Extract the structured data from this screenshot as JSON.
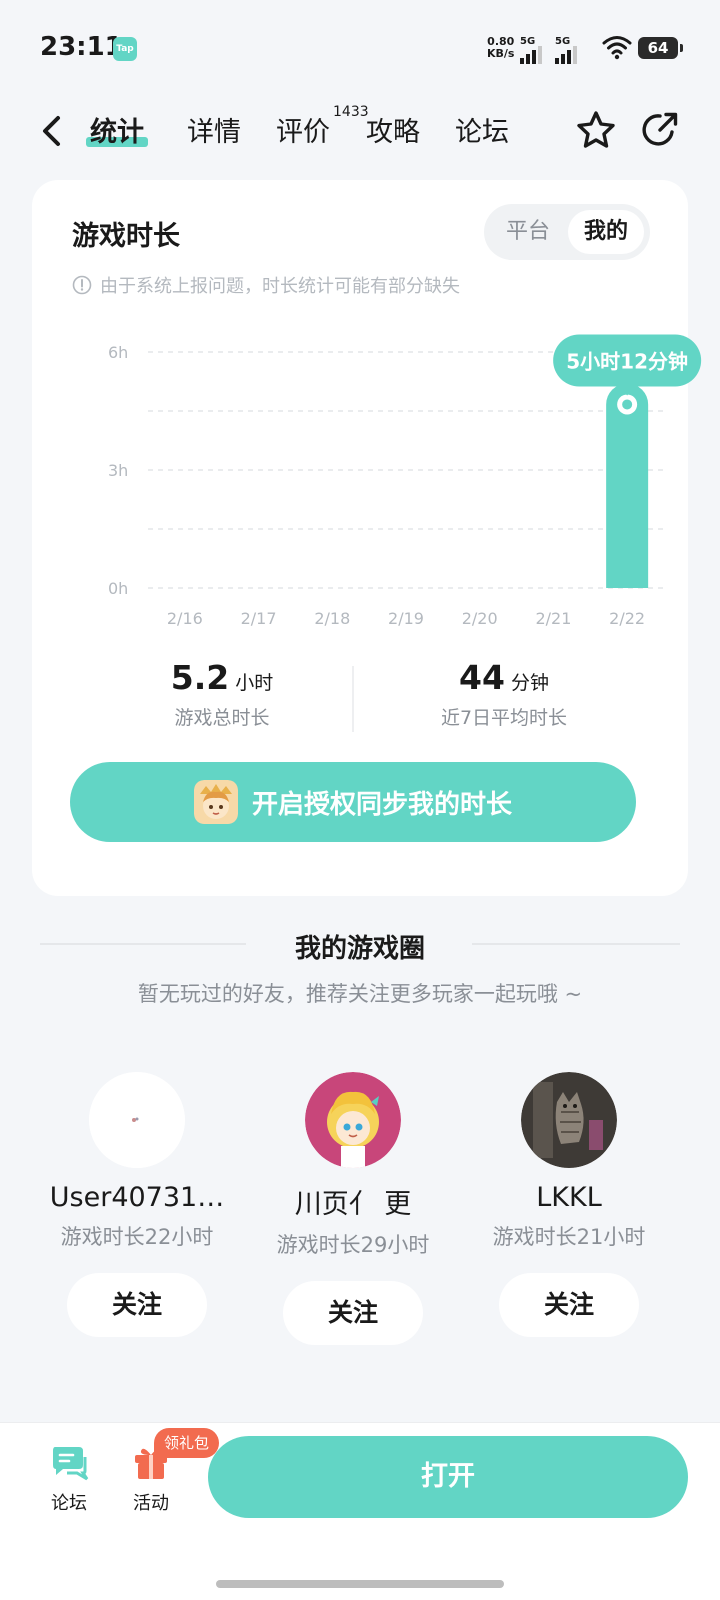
{
  "status_bar": {
    "time": "23:11",
    "app_badge": "Tap",
    "net_speed_value": "0.80",
    "net_speed_unit": "KB/s",
    "sim1": "5G",
    "sim2": "5G",
    "battery": "64"
  },
  "nav": {
    "tabs": [
      {
        "label": "统计",
        "active": true
      },
      {
        "label": "详情",
        "active": false
      },
      {
        "label": "评价",
        "active": false
      },
      {
        "label": "攻略",
        "active": false
      },
      {
        "label": "论坛",
        "active": false
      }
    ],
    "review_count": "1433"
  },
  "playtime_card": {
    "title": "游戏时长",
    "toggle": {
      "options": [
        "平台",
        "我的"
      ],
      "selected": "我的"
    },
    "notice": "由于系统上报问题，时长统计可能有部分缺失",
    "total": {
      "value": "5.2",
      "unit": "小时",
      "label": "游戏总时长"
    },
    "average": {
      "value": "44",
      "unit": "分钟",
      "label": "近7日平均时长"
    },
    "sync_button": "开启授权同步我的时长"
  },
  "chart_data": {
    "type": "bar",
    "categories": [
      "2/16",
      "2/17",
      "2/18",
      "2/19",
      "2/20",
      "2/21",
      "2/22"
    ],
    "values": [
      0,
      0,
      0,
      0,
      0,
      0,
      5.2
    ],
    "ylim": [
      0,
      6
    ],
    "yticks": [
      {
        "value": 0,
        "label": "0h"
      },
      {
        "value": 3,
        "label": "3h"
      },
      {
        "value": 6,
        "label": "6h"
      }
    ],
    "gridlines": [
      0,
      1.5,
      3,
      4.5,
      6
    ],
    "highlight": {
      "index": 6,
      "label": "5小时12分钟"
    },
    "bar_color": "#62D5C5"
  },
  "game_circle": {
    "title": "我的游戏圈",
    "subtitle": "暂无玩过的好友，推荐关注更多玩家一起玩哦 ~",
    "friends": [
      {
        "name": "User40731…",
        "playtime": "游戏时长22小时",
        "follow": "关注"
      },
      {
        "name": "川页亻 更",
        "playtime": "游戏时长29小时",
        "follow": "关注"
      },
      {
        "name": "LKKL",
        "playtime": "游戏时长21小时",
        "follow": "关注"
      }
    ]
  },
  "bottom_bar": {
    "forum": "论坛",
    "activity": "活动",
    "gift_badge": "领礼包",
    "open_button": "打开"
  },
  "colors": {
    "accent": "#62D5C5",
    "badge": "#F26B4F",
    "background": "#F4F6F9"
  }
}
